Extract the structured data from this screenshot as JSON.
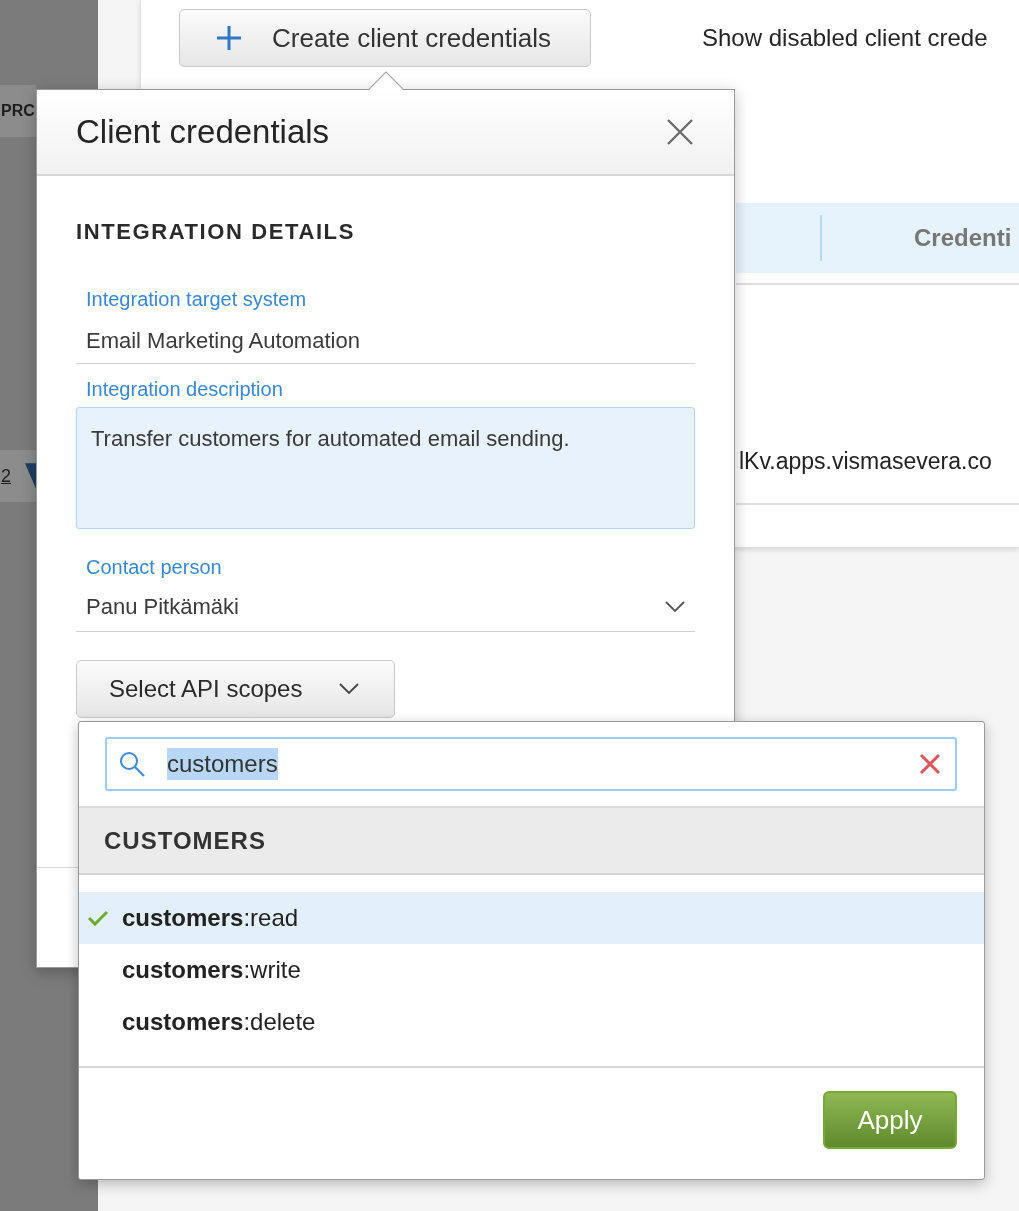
{
  "sidebar": {
    "items": [
      {
        "label": "PRC",
        "selected": false
      },
      {
        "label": "2",
        "selected": true
      }
    ]
  },
  "toolbar": {
    "create_button": "Create client credentials",
    "show_disabled_label": "Show disabled client crede"
  },
  "table": {
    "columns": [
      {
        "label": "Credenti"
      }
    ],
    "rows": [
      {
        "cells": [
          "lKv.apps.vismasevera.co"
        ]
      }
    ]
  },
  "popover": {
    "title": "Client credentials",
    "section_title": "INTEGRATION DETAILS",
    "fields": [
      {
        "kind": "text",
        "label": "Integration target system",
        "value": "Email Marketing Automation"
      },
      {
        "kind": "textarea",
        "label": "Integration description",
        "value": "Transfer customers for automated email sending."
      },
      {
        "kind": "select",
        "label": "Contact person",
        "value": "Panu Pitkämäki"
      }
    ],
    "scopes_button": "Select API scopes"
  },
  "scope_dropdown": {
    "search": {
      "value": "customers",
      "text_selected": true
    },
    "groups": [
      {
        "title": "CUSTOMERS",
        "items": [
          {
            "label": "**customers**:read",
            "selected": true
          },
          {
            "label": "**customers**:write",
            "selected": false
          },
          {
            "label": "**customers**:delete",
            "selected": false
          }
        ]
      }
    ],
    "apply_button": "Apply"
  }
}
